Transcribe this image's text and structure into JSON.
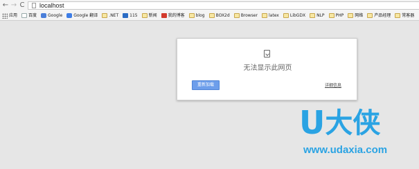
{
  "toolbar": {
    "back_glyph": "←",
    "forward_glyph": "→",
    "reload_glyph": "C",
    "url": "localhost"
  },
  "bookmarks": [
    {
      "label": "应用",
      "icon": "apps-icon"
    },
    {
      "label": "百度",
      "icon": "page-icon"
    },
    {
      "label": "Google",
      "icon": "google-icon"
    },
    {
      "label": "Google 翻译",
      "icon": "translate-icon"
    },
    {
      "label": ".NET",
      "icon": "folder-icon"
    },
    {
      "label": "115",
      "icon": "115-icon"
    },
    {
      "label": "新闻",
      "icon": "folder-icon"
    },
    {
      "label": "我的博客",
      "icon": "blog-icon"
    },
    {
      "label": "blog",
      "icon": "folder-icon"
    },
    {
      "label": "BOX2d",
      "icon": "folder-icon"
    },
    {
      "label": "Browser",
      "icon": "folder-icon"
    },
    {
      "label": "latex",
      "icon": "folder-icon"
    },
    {
      "label": "LibGDX",
      "icon": "folder-icon"
    },
    {
      "label": "NLP",
      "icon": "folder-icon"
    },
    {
      "label": "PHP",
      "icon": "folder-icon"
    },
    {
      "label": "网络",
      "icon": "folder-icon"
    },
    {
      "label": "产品经理",
      "icon": "folder-icon"
    },
    {
      "label": "常客器",
      "icon": "folder-icon"
    }
  ],
  "error": {
    "title": "无法显示此网页",
    "reload_label": "重新加载",
    "details_label": "详细信息"
  },
  "watermark": {
    "logo_u": "U",
    "logo_cn": "大侠",
    "url": "www.udaxia.com"
  },
  "colors": {
    "accent_button": "#6d9eeb",
    "watermark": "#2aa3e3",
    "page_background": "#e6e6e6"
  }
}
